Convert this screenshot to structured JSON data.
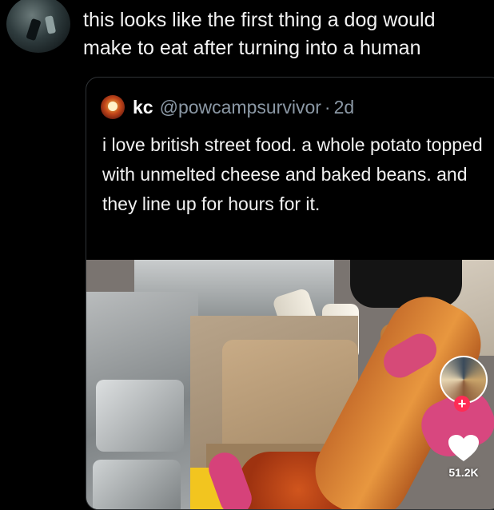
{
  "reply": {
    "text": "this looks like the first thing a dog would make to eat after turning into a human"
  },
  "quote": {
    "name": "kc",
    "handle": "@powcampsurvivor",
    "separator": "·",
    "time": "2d",
    "text": "i love british street food. a whole potato topped with unmelted cheese and baked beans. and they line up for hours for it."
  },
  "video": {
    "add_glyph": "+",
    "like_count": "51.2K"
  },
  "icons": {
    "heart": "heart-icon",
    "plus": "plus-icon"
  },
  "colors": {
    "background": "#000000",
    "handle": "#8b98a5",
    "accent": "#fe2c55"
  }
}
